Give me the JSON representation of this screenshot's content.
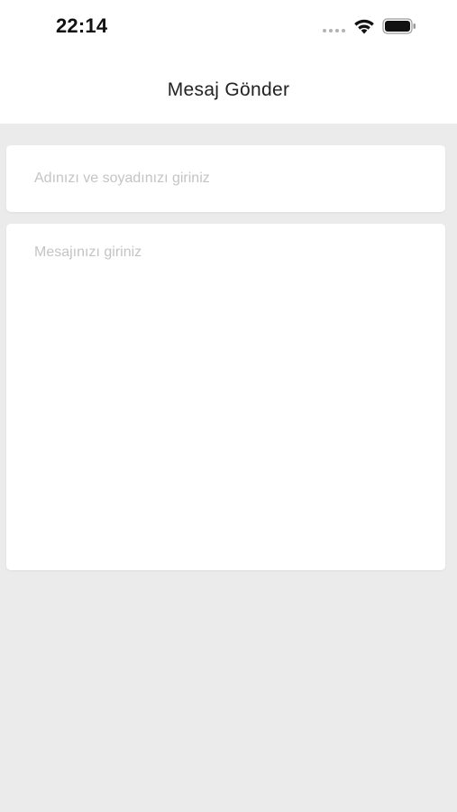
{
  "status_bar": {
    "time": "22:14",
    "icons": [
      "signal-dots-icon",
      "wifi-icon",
      "battery-icon"
    ]
  },
  "header": {
    "title": "Mesaj Gönder"
  },
  "form": {
    "name_field": {
      "value": "",
      "placeholder": "Adınızı ve soyadınızı giriniz"
    },
    "message_field": {
      "value": "",
      "placeholder": "Mesajınızı giriniz"
    }
  },
  "colors": {
    "background": "#ebebeb",
    "card": "#ffffff",
    "placeholder": "#c4c4c4",
    "title": "#222222"
  }
}
